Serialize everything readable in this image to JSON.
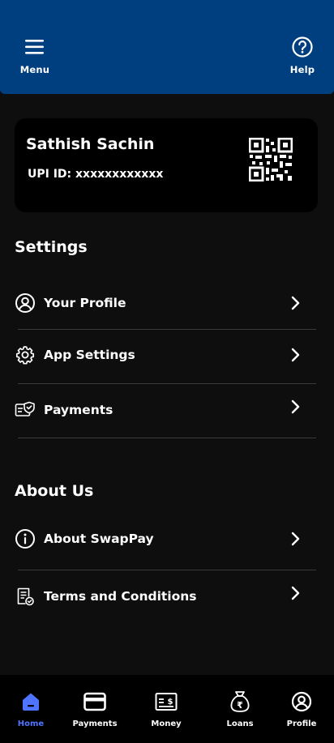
{
  "header": {
    "menu_label": "Menu",
    "help_label": "Help",
    "menu_icon": "hamburger-menu-icon",
    "help_icon": "question-circle-icon"
  },
  "profile_card": {
    "name": "Sathish Sachin",
    "upi_id": "UPI ID: xxxxxxxxxxxx",
    "qr_icon": "qr-code-icon"
  },
  "settings": {
    "title": "Settings",
    "items": [
      {
        "label": "Your Profile",
        "icon": "user-circle-icon"
      },
      {
        "label": "App Settings",
        "icon": "gear-icon"
      },
      {
        "label": "Payments",
        "icon": "card-shield-icon"
      }
    ]
  },
  "about": {
    "title": "About Us",
    "items": [
      {
        "label": "About SwapPay",
        "icon": "info-circle-icon"
      },
      {
        "label": "Terms and Conditions",
        "icon": "document-check-icon"
      }
    ]
  },
  "bottom_nav": {
    "items": [
      {
        "label": "Home",
        "icon": "home-icon",
        "active": true
      },
      {
        "label": "Payments",
        "icon": "credit-card-icon",
        "active": false
      },
      {
        "label": "Money",
        "icon": "cash-icon",
        "active": false
      },
      {
        "label": "Loans",
        "icon": "money-bag-icon",
        "active": false
      },
      {
        "label": "Profile",
        "icon": "user-circle-icon",
        "active": false
      }
    ]
  },
  "colors": {
    "header_bg": "#003f7f",
    "page_bg": "#0e0e0e",
    "card_bg": "#000000",
    "accent": "#4f74ff",
    "divider": "#3a3a3a"
  }
}
